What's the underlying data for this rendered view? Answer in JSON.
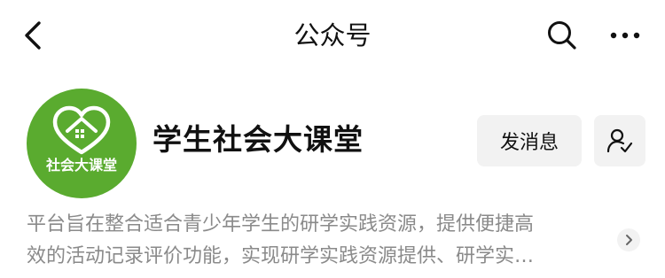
{
  "nav": {
    "title": "公众号",
    "icons": {
      "back": "chevron-left-icon",
      "search": "search-icon",
      "more": "more-dots-icon"
    }
  },
  "account": {
    "avatar_text": "社会大课堂",
    "avatar_color": "#5aab2f",
    "name": "学生社会大课堂",
    "message_button": "发消息",
    "follow_icon": "person-check-icon",
    "description_line1": "平台旨在整合适合青少年学生的研学实践资源，提供便捷高",
    "description_line2": "效的活动记录评价功能，实现研学实践资源提供、研学实…"
  }
}
